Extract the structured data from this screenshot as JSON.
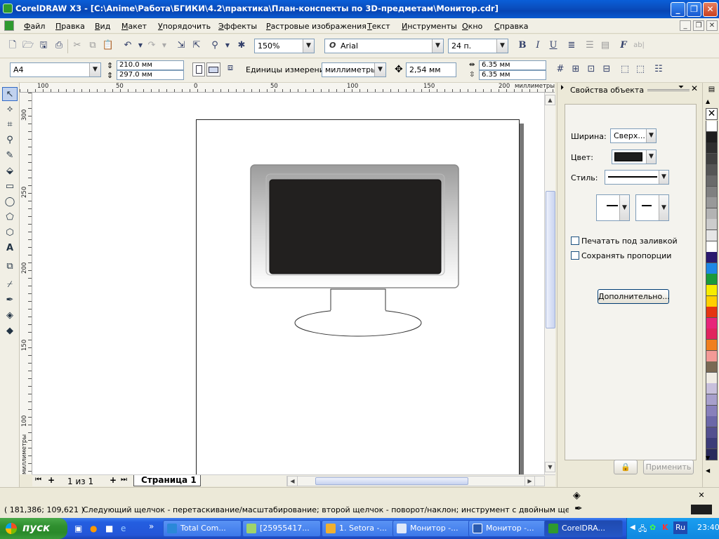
{
  "window": {
    "title": "CorelDRAW X3 - [C:\\Anime\\Работа\\БГИКИ\\4.2\\практика\\План-конспекты по 3D-предметам\\Монитор.cdr]",
    "min": "_",
    "max": "❐",
    "close": "✕"
  },
  "menu": {
    "items": [
      "Файл",
      "Правка",
      "Вид",
      "Макет",
      "Упорядочить",
      "Эффекты",
      "Растровые изображения",
      "Текст",
      "Инструменты",
      "Окно",
      "Справка"
    ]
  },
  "standard_toolbar": {
    "zoom": "150%",
    "font": "Arial",
    "font_size": "24 п."
  },
  "property_bar": {
    "page_size": "A4",
    "width": "210.0 мм",
    "height": "297.0 мм",
    "units_label": "Единицы измерения:",
    "units": "миллиметры",
    "nudge": "2,54 мм",
    "dup_x": "6.35 мм",
    "dup_y": "6.35 мм"
  },
  "ruler": {
    "h_labels": [
      "100",
      "50",
      "0",
      "50",
      "100",
      "150",
      "200"
    ],
    "h_unit": "миллиметры",
    "v_labels": [
      "300",
      "250",
      "200",
      "150",
      "100"
    ],
    "v_unit": "миллиметры"
  },
  "page_nav": {
    "counter": "1 из 1",
    "tab": "Страница 1"
  },
  "docker": {
    "title": "Свойства объекта",
    "width_label": "Ширина:",
    "width_value": "Сверх...",
    "color_label": "Цвет:",
    "color_value": "#1e1e1e",
    "style_label": "Стиль:",
    "checkbox_print_under_fill": "Печатать под заливкой",
    "checkbox_keep_proportions": "Сохранять пропорции",
    "advanced_button": "Дополнительно...",
    "apply_button": "Применить"
  },
  "palette": {
    "colors": [
      "#ffffff",
      "#1e1e1e",
      "#2e2e2e",
      "#404040",
      "#555555",
      "#6a6a6a",
      "#808080",
      "#999999",
      "#b3b3b3",
      "#cccccc",
      "#e6e6e6",
      "#ffffff",
      "#2b1a6e",
      "#1e88e5",
      "#1a9a3a",
      "#f7ec00",
      "#ffd000",
      "#e53512",
      "#e8247a",
      "#e0245e",
      "#f07f1e",
      "#f39a96",
      "#7a6a54",
      "#f0ece4",
      "#c8c0dc",
      "#a8a0cc",
      "#8880bb",
      "#6c68a8",
      "#54508f",
      "#3c3c78",
      "#2a2a5c"
    ]
  },
  "status": {
    "coords": "( 181,386; 109,621 )",
    "message": "Следующий щелчок - перетаскивание/масштабирование; второй щелчок - поворот/наклон; инструмент с двойным щелчком выбира..."
  },
  "taskbar": {
    "start": "пуск",
    "tasks": [
      "Total Com...",
      "[25955417...",
      "1. Setora -...",
      "Монитор -...",
      "Монитор -...",
      "CorelDRA..."
    ],
    "lang": "Ru",
    "clock": "23:40"
  }
}
